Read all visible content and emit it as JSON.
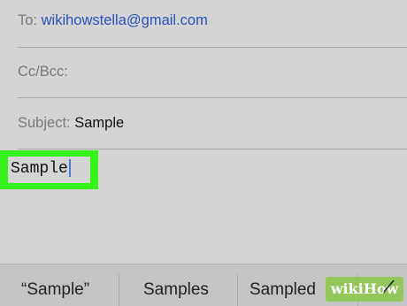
{
  "fields": {
    "to_label": "To:",
    "to_value": "wikihowstella@gmail.com",
    "cc_label": "Cc/Bcc:",
    "subject_label": "Subject:",
    "subject_value": "Sample"
  },
  "body": {
    "text": "Sample"
  },
  "suggestions": [
    {
      "label": "“Sample”"
    },
    {
      "label": "Samples"
    },
    {
      "label": "Sampled"
    }
  ],
  "watermark": "wikiHow",
  "colors": {
    "highlight": "#35f31a",
    "link": "#2b4fbf"
  }
}
